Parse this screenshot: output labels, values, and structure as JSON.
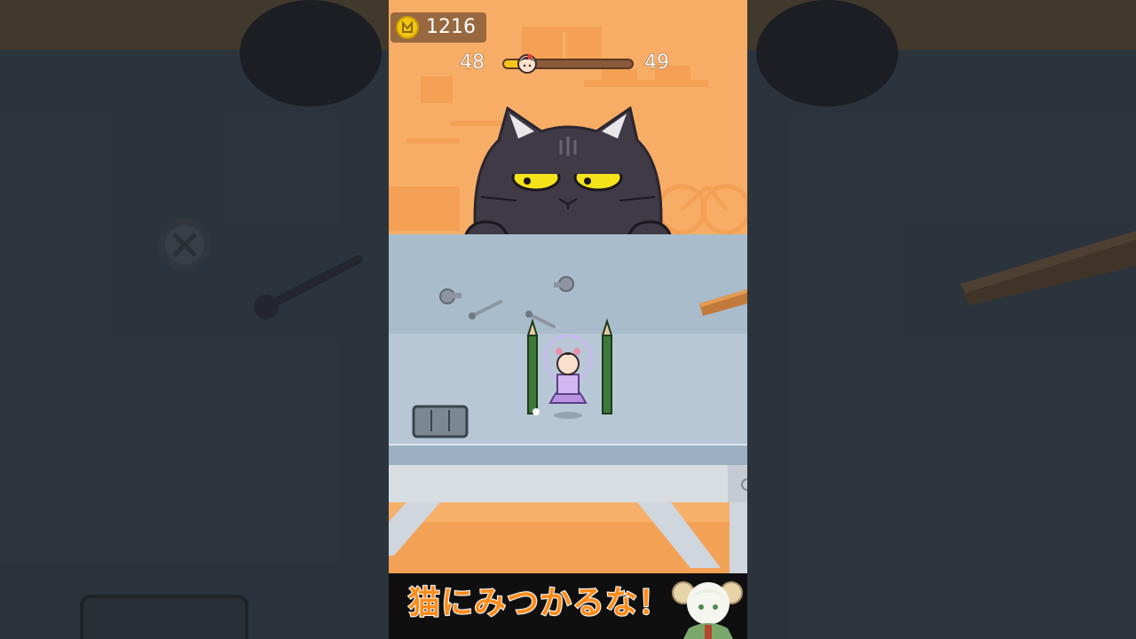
{
  "hud": {
    "coins": "1216",
    "coin_icon": "coin-icon",
    "level_current": "48",
    "level_next": "49",
    "level_progress_fraction": 0.12
  },
  "banner": {
    "caption": "猫にみつかるな！"
  },
  "colors": {
    "wall": "#f8ad66",
    "table": "#b7c7d6",
    "cat_body": "#3f3a45",
    "cat_eyes": "#f5e31a",
    "banner_text": "#ff8c1a",
    "coin": "#f2c511"
  }
}
